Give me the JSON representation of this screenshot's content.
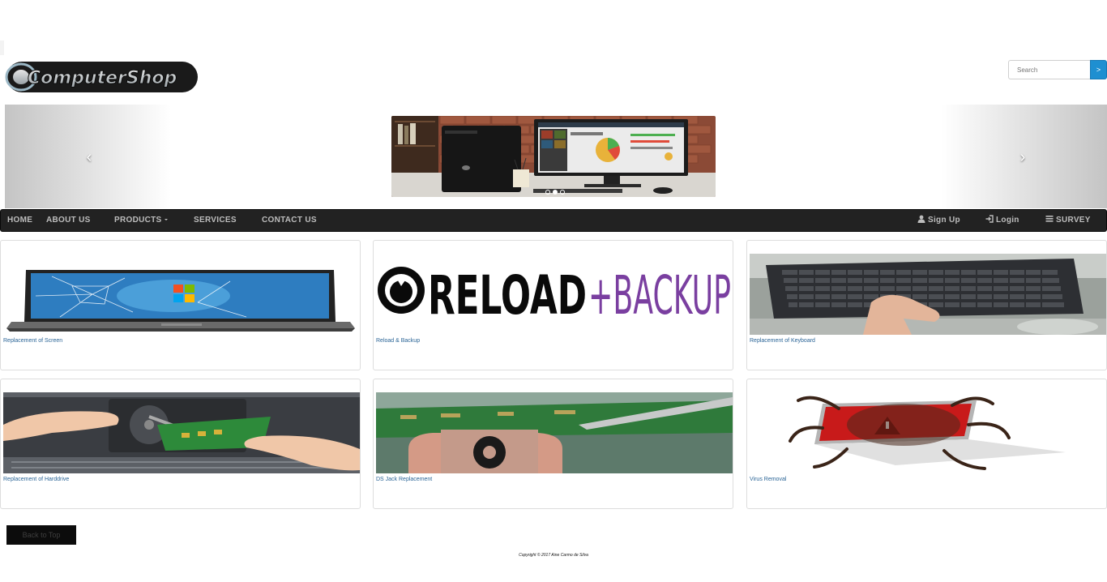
{
  "brand": {
    "logo_text": "ComputerShop"
  },
  "search": {
    "placeholder": "Search",
    "button_label": ">"
  },
  "carousel": {
    "prev_label": "‹",
    "next_label": "›",
    "slides_count": 3,
    "active_slide": 2
  },
  "nav": {
    "left": [
      {
        "label": "HOME"
      },
      {
        "label": "ABOUT US"
      },
      {
        "label": "PRODUCTS"
      },
      {
        "label": "SERVICES"
      },
      {
        "label": "CONTACT US"
      }
    ],
    "right": [
      {
        "label": "Sign Up",
        "icon": "user-icon"
      },
      {
        "label": "Login",
        "icon": "login-icon"
      },
      {
        "label": "SURVEY",
        "icon": "list-icon"
      }
    ]
  },
  "products": [
    {
      "caption": "Replacement of Screen",
      "image": "broken-laptop-screen"
    },
    {
      "caption": "Reload & Backup",
      "image": "reload-backup-logo",
      "logo_words": [
        "RELOAD",
        "+BACKUP"
      ]
    },
    {
      "caption": "Replacement of Keyboard",
      "image": "keyboard-replacement"
    },
    {
      "caption": "Replacement of Harddrive",
      "image": "harddrive-replacement"
    },
    {
      "caption": "DS Jack Replacement",
      "image": "dc-jack-soldering"
    },
    {
      "caption": "Virus Removal",
      "image": "virus-laptop"
    }
  ],
  "footer": {
    "back_to_top": "Back to Top",
    "copyright": "Copyright © 2017 Aine Carmo de Silva"
  },
  "colors": {
    "navbar_bg": "#222222",
    "nav_text": "#bdbdbd",
    "link_blue": "#2a6496",
    "search_button": "#1e8fd1",
    "reload_purple": "#7a3fa0"
  }
}
